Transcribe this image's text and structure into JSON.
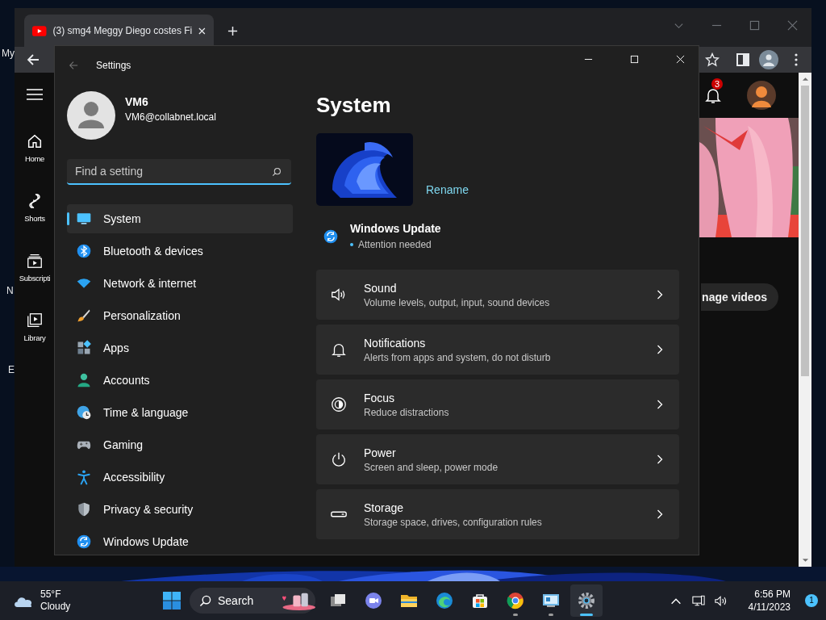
{
  "desktop": {
    "labels": [
      "My",
      "N",
      "E"
    ]
  },
  "browser": {
    "tab": {
      "title": "(3) smg4 Meggy Diego costes Fi"
    },
    "youtube": {
      "nav": [
        {
          "label": "Home"
        },
        {
          "label": "Shorts"
        },
        {
          "label": "Subscripti"
        },
        {
          "label": "Library"
        }
      ],
      "notification_count": "3",
      "manage_button": "nage videos"
    }
  },
  "settings": {
    "title": "Settings",
    "user": {
      "name": "VM6",
      "email": "VM6@collabnet.local"
    },
    "search": {
      "placeholder": "Find a setting"
    },
    "nav": [
      {
        "label": "System",
        "selected": true
      },
      {
        "label": "Bluetooth & devices",
        "selected": false
      },
      {
        "label": "Network & internet",
        "selected": false
      },
      {
        "label": "Personalization",
        "selected": false
      },
      {
        "label": "Apps",
        "selected": false
      },
      {
        "label": "Accounts",
        "selected": false
      },
      {
        "label": "Time & language",
        "selected": false
      },
      {
        "label": "Gaming",
        "selected": false
      },
      {
        "label": "Accessibility",
        "selected": false
      },
      {
        "label": "Privacy & security",
        "selected": false
      },
      {
        "label": "Windows Update",
        "selected": false
      }
    ],
    "page_title": "System",
    "rename": "Rename",
    "update": {
      "title": "Windows Update",
      "status": "Attention needed"
    },
    "cards": [
      {
        "title": "Sound",
        "subtitle": "Volume levels, output, input, sound devices"
      },
      {
        "title": "Notifications",
        "subtitle": "Alerts from apps and system, do not disturb"
      },
      {
        "title": "Focus",
        "subtitle": "Reduce distractions"
      },
      {
        "title": "Power",
        "subtitle": "Screen and sleep, power mode"
      },
      {
        "title": "Storage",
        "subtitle": "Storage space, drives, configuration rules"
      }
    ]
  },
  "taskbar": {
    "weather": {
      "temp": "55°F",
      "condition": "Cloudy"
    },
    "search": "Search",
    "apps": [
      {
        "running": false,
        "active": false
      },
      {
        "running": false,
        "active": false
      },
      {
        "running": false,
        "active": false
      },
      {
        "running": false,
        "active": false
      },
      {
        "running": false,
        "active": false
      },
      {
        "running": true,
        "active": false
      },
      {
        "running": true,
        "active": false
      },
      {
        "running": true,
        "active": true
      }
    ],
    "clock": {
      "time": "6:56 PM",
      "date": "4/11/2023"
    },
    "notification_count": "1"
  }
}
